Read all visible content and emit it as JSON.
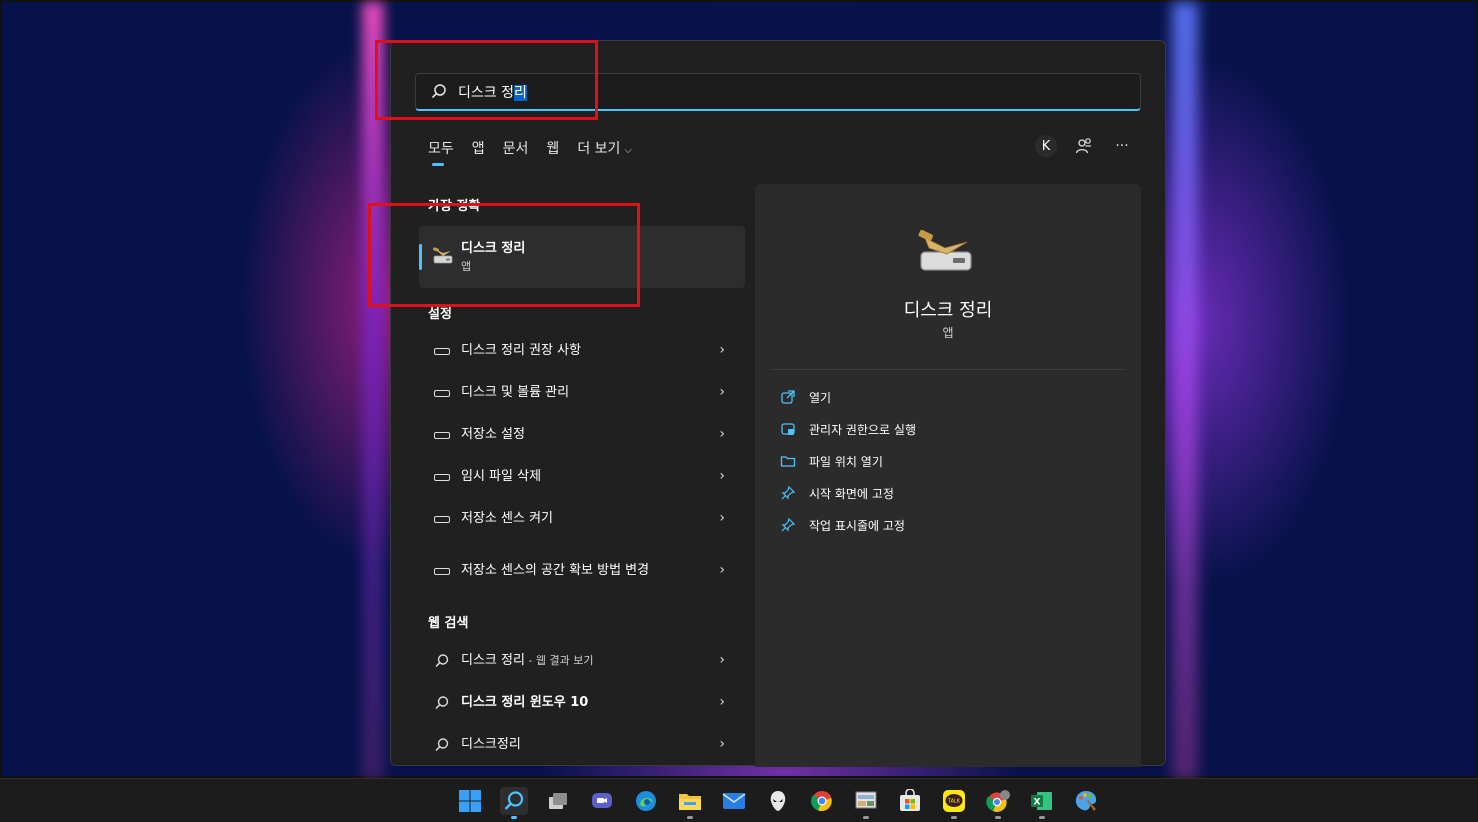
{
  "search": {
    "query_prefix": "디스크 정",
    "query_selected": "리"
  },
  "filter_tabs": [
    {
      "label": "모두",
      "active": true
    },
    {
      "label": "앱"
    },
    {
      "label": "문서"
    },
    {
      "label": "웹"
    },
    {
      "label": "더 보기"
    }
  ],
  "account_initial": "K",
  "more_label": "···",
  "best_match": {
    "section_label": "가장 정확",
    "title": "디스크 정리",
    "subtitle": "앱"
  },
  "settings": {
    "section_label": "설정",
    "items": [
      {
        "label": "디스크 정리 권장 사항"
      },
      {
        "label": "디스크 및 볼륨 관리"
      },
      {
        "label": "저장소 설정"
      },
      {
        "label": "임시 파일 삭제"
      },
      {
        "label": "저장소 센스 켜기"
      },
      {
        "label": "저장소 센스의 공간 확보 방법 변경"
      }
    ]
  },
  "web_search": {
    "section_label": "웹 검색",
    "items": [
      {
        "label": "디스크 정리",
        "sub": " - 웹 결과 보기"
      },
      {
        "label": "디스크 정리 윈도우 10"
      },
      {
        "label": "디스크정리"
      }
    ]
  },
  "preview": {
    "title": "디스크 정리",
    "subtitle": "앱",
    "actions": [
      {
        "label": "열기",
        "icon": "open-external-icon"
      },
      {
        "label": "관리자 권한으로 실행",
        "icon": "shield-admin-icon"
      },
      {
        "label": "파일 위치 열기",
        "icon": "folder-icon"
      },
      {
        "label": "시작 화면에 고정",
        "icon": "pin-icon"
      },
      {
        "label": "작업 표시줄에 고정",
        "icon": "pin-icon"
      }
    ]
  },
  "taskbar": {
    "icons": [
      "windows-start-icon",
      "search-icon",
      "task-view-icon",
      "chat-icon",
      "edge-icon",
      "file-explorer-icon",
      "mail-icon",
      "alienware-icon",
      "chrome-icon",
      "control-panel-icon",
      "microsoft-store-icon",
      "kakaotalk-icon",
      "chrome-profile-icon",
      "excel-icon",
      "paint-icon"
    ],
    "kakaotalk_label": "TALK"
  },
  "colors": {
    "accent": "#4cc2ff",
    "highlight_red": "#e0101a",
    "panel_bg": "#202020",
    "preview_bg": "#2b2b2b"
  }
}
